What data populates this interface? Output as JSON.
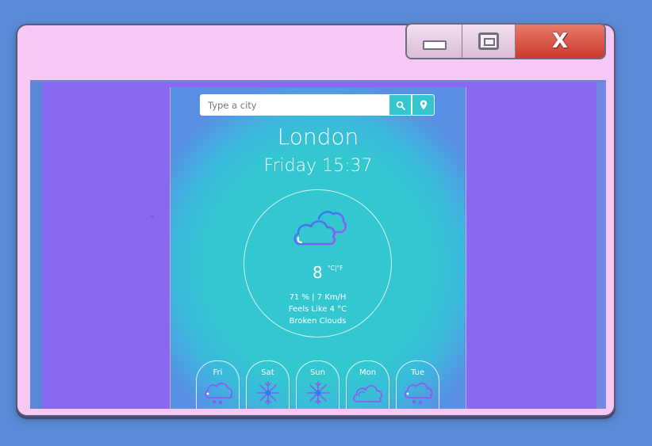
{
  "window": {
    "controls": {
      "minimize_icon": "minimize-icon",
      "maximize_icon": "maximize-icon",
      "close_label": "X"
    }
  },
  "search": {
    "placeholder": "Type a city",
    "value": "",
    "search_icon": "search-icon",
    "location_icon": "location-pin-icon"
  },
  "weather": {
    "city": "London",
    "datetime": "Friday 15:37",
    "icon": "broken-clouds-icon",
    "temperature": "8",
    "units": "°C|°F",
    "humidity_wind": "71 % | 7 Km/H",
    "feels_like": "Feels Like 4 °C",
    "description": "Broken Clouds"
  },
  "forecast": [
    {
      "day": "Fri",
      "icon": "cloud-snow-icon"
    },
    {
      "day": "Sat",
      "icon": "snowflake-icon"
    },
    {
      "day": "Sun",
      "icon": "snowflake-icon"
    },
    {
      "day": "Mon",
      "icon": "cloud-icon"
    },
    {
      "day": "Tue",
      "icon": "cloud-snow-icon"
    }
  ],
  "colors": {
    "background": "#5b8bd6",
    "window_frame": "#f6c9f4",
    "viewport": "#8b68f0",
    "app_teal": "#33c8d0",
    "icon_purple": "#8a5cf0",
    "close_red": "#d24a3c"
  }
}
